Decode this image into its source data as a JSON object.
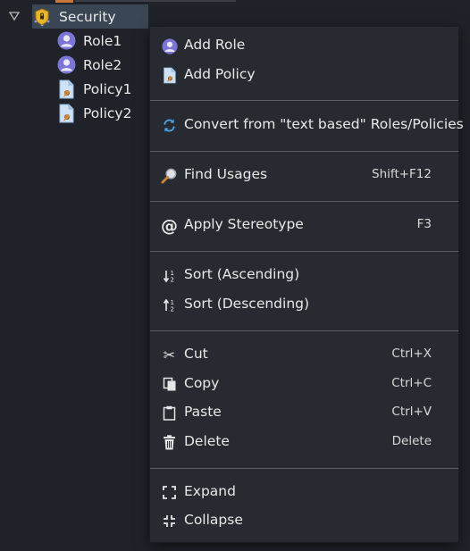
{
  "tree": {
    "root": {
      "label": "Security",
      "icon": "shield-icon"
    },
    "children": [
      {
        "label": "Role1",
        "icon": "role-icon"
      },
      {
        "label": "Role2",
        "icon": "role-icon"
      },
      {
        "label": "Policy1",
        "icon": "policy-icon"
      },
      {
        "label": "Policy2",
        "icon": "policy-icon"
      }
    ]
  },
  "menu": {
    "add_role": {
      "label": "Add Role"
    },
    "add_policy": {
      "label": "Add Policy"
    },
    "convert": {
      "label": "Convert from \"text based\" Roles/Policies"
    },
    "find_usages": {
      "label": "Find Usages",
      "shortcut": "Shift+F12"
    },
    "apply_stereotype": {
      "label": "Apply Stereotype",
      "shortcut": "F3"
    },
    "sort_asc": {
      "label": "Sort (Ascending)"
    },
    "sort_desc": {
      "label": "Sort (Descending)"
    },
    "cut": {
      "label": "Cut",
      "shortcut": "Ctrl+X"
    },
    "copy": {
      "label": "Copy",
      "shortcut": "Ctrl+C"
    },
    "paste": {
      "label": "Paste",
      "shortcut": "Ctrl+V"
    },
    "delete": {
      "label": "Delete",
      "shortcut": "Delete"
    },
    "expand": {
      "label": "Expand"
    },
    "collapse": {
      "label": "Collapse"
    }
  },
  "colors": {
    "background": "#1f2329",
    "menu_background": "#272b31",
    "selection": "#3a4654",
    "role_purple": "#7b76d6",
    "shield_gold": "#e8b531"
  }
}
